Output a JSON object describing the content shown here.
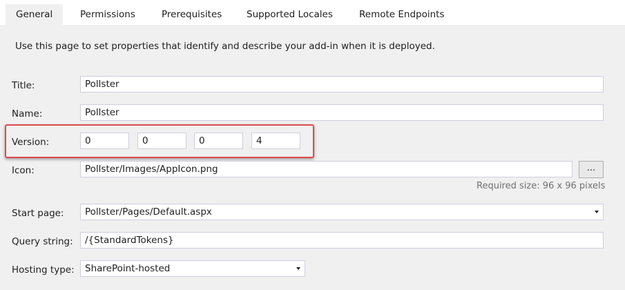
{
  "tabs": [
    "General",
    "Permissions",
    "Prerequisites",
    "Supported Locales",
    "Remote Endpoints"
  ],
  "description": "Use this page to set properties that identify and describe your add-in when it is deployed.",
  "form": {
    "title": {
      "label": "Title:",
      "value": "Pollster"
    },
    "name": {
      "label": "Name:",
      "value": "Pollster"
    },
    "version": {
      "label": "Version:",
      "parts": [
        "0",
        "0",
        "0",
        "4"
      ]
    },
    "icon": {
      "label": "Icon:",
      "value": "Pollster/Images/AppIcon.png",
      "browse_label": "...",
      "hint": "Required size: 96 x 96 pixels"
    },
    "start_page": {
      "label": "Start page:",
      "value": "Pollster/Pages/Default.aspx"
    },
    "query_string": {
      "label": "Query string:",
      "value": "/{StandardTokens}"
    },
    "hosting_type": {
      "label": "Hosting type:",
      "value": "SharePoint-hosted"
    }
  },
  "colors": {
    "highlight": "#e04a4a",
    "field_border": "#cccedb",
    "background": "#f0f0f0"
  }
}
